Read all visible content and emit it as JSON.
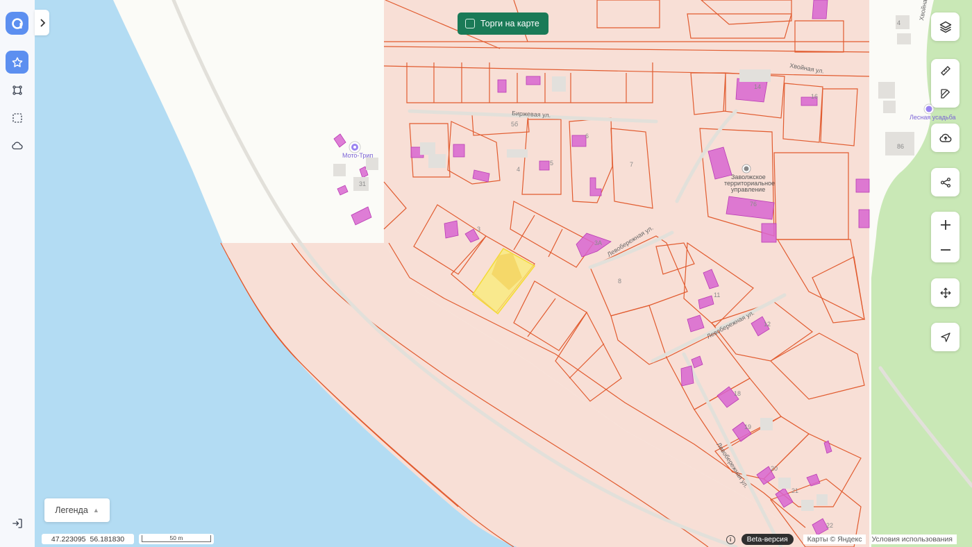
{
  "toggle": {
    "label": "Торги на карте"
  },
  "legend": {
    "label": "Легенда"
  },
  "coordinates": {
    "lat": "47.223095",
    "lon": "56.181830"
  },
  "scale": {
    "label": "50 m"
  },
  "footer": {
    "beta": "Beta-версия",
    "provider": "Карты © Яндекс",
    "terms": "Условия использования"
  },
  "map": {
    "streets": [
      "Биржевая ул.",
      "Хвойная ул.",
      "Левобережная ул.",
      "Левобережная ул.",
      "Левобережная ул.",
      "Хвойная"
    ],
    "pois": [
      "Мото-Трип",
      "Лесная усадьба"
    ],
    "buildings": [
      "Заволжское",
      "территориальное",
      "управление"
    ],
    "house_numbers": [
      "4",
      "14",
      "16",
      "86",
      "5б",
      "5",
      "6",
      "7",
      "4",
      "31",
      "3",
      "3А",
      "8",
      "11",
      "76",
      "12",
      "18",
      "19",
      "20",
      "21",
      "22"
    ]
  },
  "colors": {
    "water": "#b3dcf3",
    "parcel_fill": "#f9ddd4",
    "parcel_stroke": "#e15b2f",
    "building": "#d866d0",
    "selection": "#f9ec74",
    "forest": "#c8e8b4",
    "accent": "#5c8ff0",
    "toggle_bg": "#1a7a57"
  }
}
